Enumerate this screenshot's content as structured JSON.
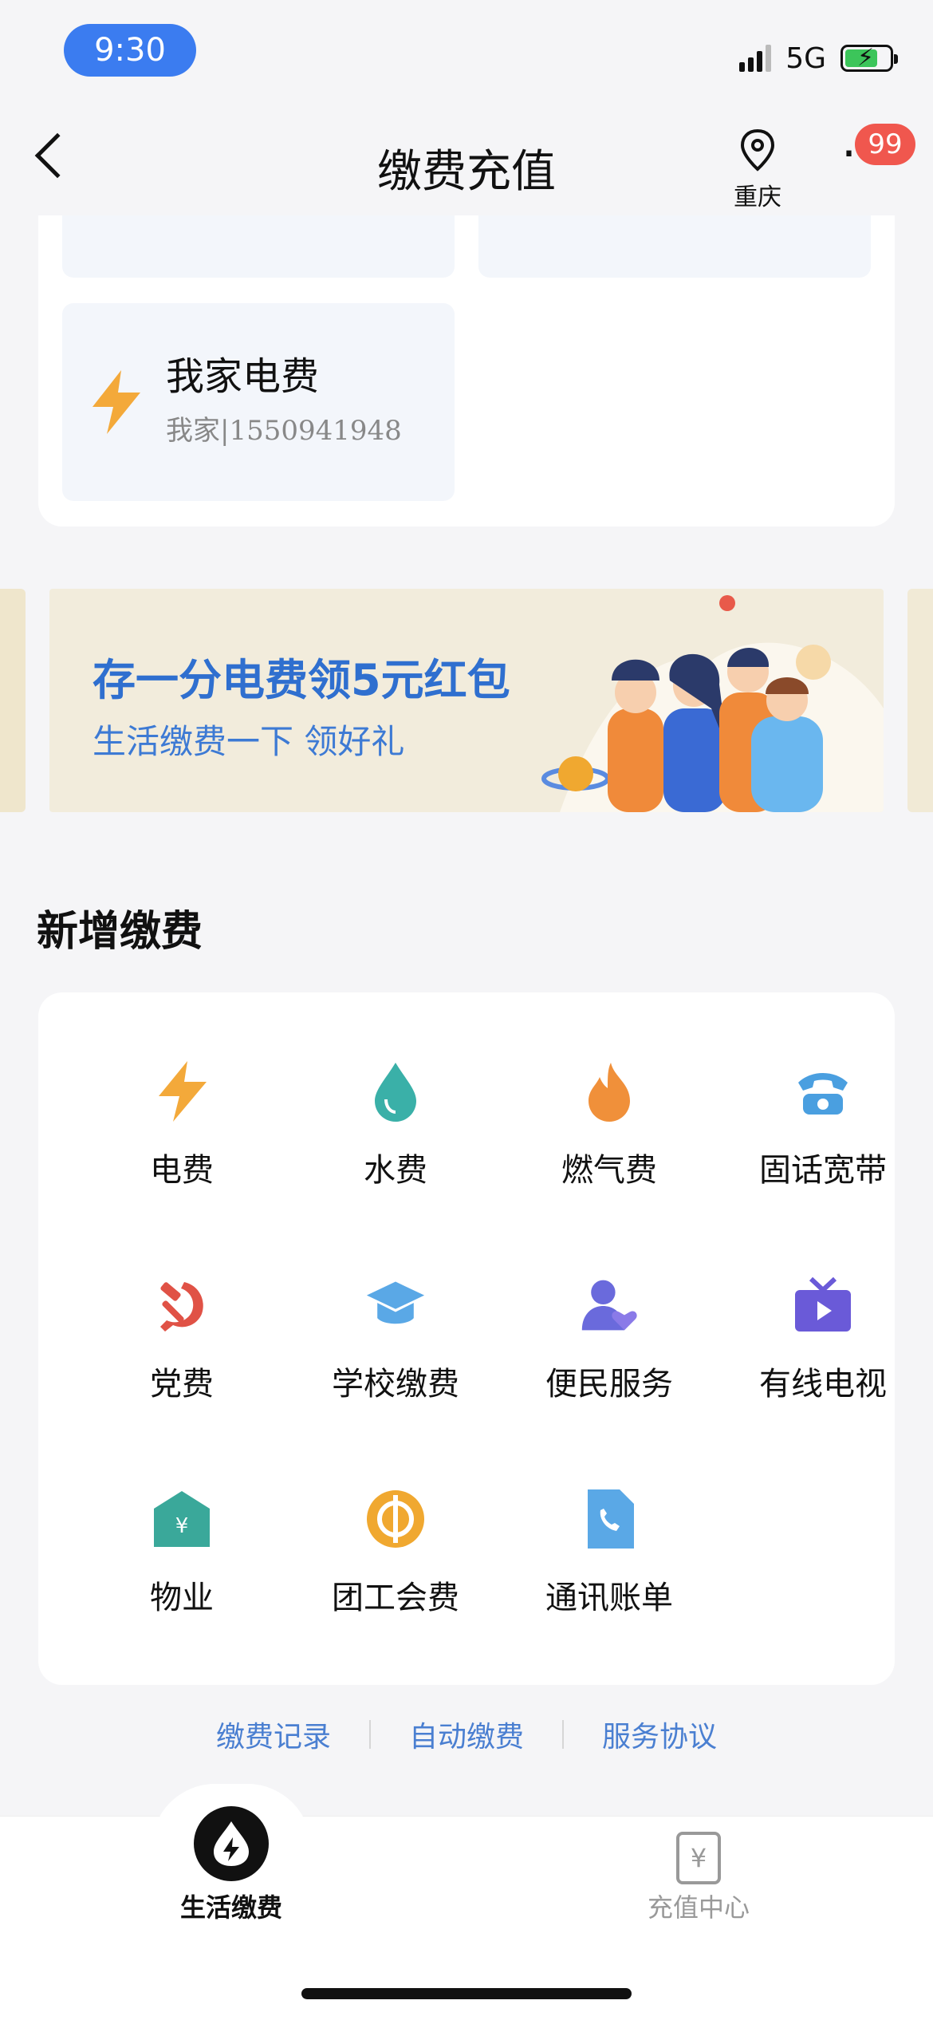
{
  "status_bar": {
    "time": "9:30",
    "network": "5G"
  },
  "nav": {
    "title": "缴费充值",
    "location": "重庆",
    "more_badge": "99"
  },
  "saved_bills": [
    {
      "name": "我家电费",
      "subtitle": "我家|1550941948",
      "icon": "lightning-icon"
    }
  ],
  "banner": {
    "title": "存一分电费领5元红包",
    "subtitle": "生活缴费一下 领好礼"
  },
  "new_payment": {
    "heading": "新增缴费",
    "items": [
      {
        "label": "电费",
        "icon": "lightning-icon",
        "color": "#f3a93a"
      },
      {
        "label": "水费",
        "icon": "water-drop-icon",
        "color": "#3ab0a8"
      },
      {
        "label": "燃气费",
        "icon": "flame-icon",
        "color": "#f0903a"
      },
      {
        "label": "固话宽带",
        "icon": "telephone-icon",
        "color": "#4a9fe0"
      },
      {
        "label": "党费",
        "icon": "hammer-sickle-icon",
        "color": "#e05246"
      },
      {
        "label": "学校缴费",
        "icon": "graduation-cap-icon",
        "color": "#5aa8e6"
      },
      {
        "label": "便民服务",
        "icon": "user-heart-icon",
        "color": "#6a6adc"
      },
      {
        "label": "有线电视",
        "icon": "tv-icon",
        "color": "#6a5ad8"
      },
      {
        "label": "物业",
        "icon": "house-yen-icon",
        "color": "#3aa89a"
      },
      {
        "label": "团工会费",
        "icon": "union-coin-icon",
        "color": "#f0a830"
      },
      {
        "label": "通讯账单",
        "icon": "phone-bill-icon",
        "color": "#5aa8e6"
      }
    ]
  },
  "links": [
    "缴费记录",
    "自动缴费",
    "服务协议"
  ],
  "tabbar": [
    {
      "label": "生活缴费",
      "icon": "life-payment-icon",
      "active": true
    },
    {
      "label": "充值中心",
      "icon": "recharge-icon",
      "active": false
    }
  ]
}
